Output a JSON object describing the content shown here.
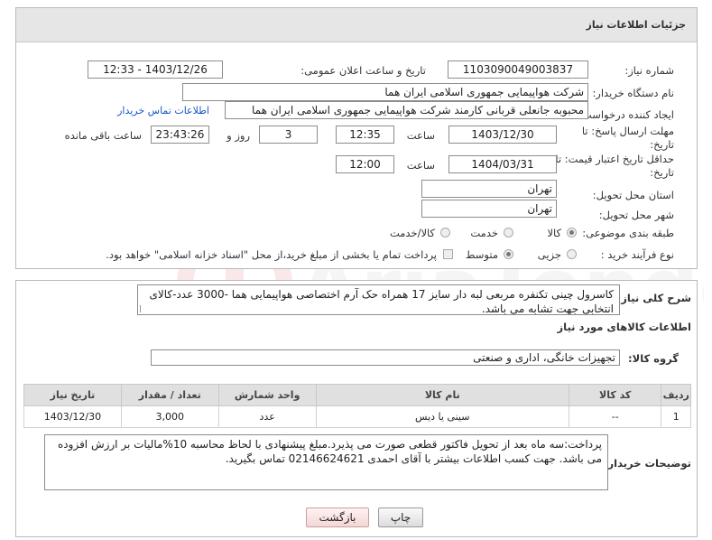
{
  "header": {
    "title": "جزئیات اطلاعات نیاز"
  },
  "form": {
    "need_number_label": "شماره نیاز:",
    "need_number": "1103090049003837",
    "announce_label": "تاریخ و ساعت اعلان عمومی:",
    "announce_value": "1403/12/26 - 12:33",
    "buyer_label": "نام دستگاه خریدار:",
    "buyer": "شرکت هواپیمایی جمهوری اسلامی ایران هما",
    "creator_label": "ایجاد کننده درخواست:",
    "creator": "محبوبه جانعلی قربانی کارمند شرکت هواپیمایی جمهوری اسلامی ایران هما",
    "contact_link": "اطلاعات تماس خریدار",
    "deadline_label_1": "مهلت ارسال پاسخ: تا",
    "deadline_label_2": "تاریخ:",
    "deadline_date": "1403/12/30",
    "time_label": "ساعت",
    "deadline_time": "12:35",
    "days_value": "3",
    "days_label": "روز و",
    "remaining_time": "23:43:26",
    "remaining_label": "ساعت باقی مانده",
    "validity_label_1": "حداقل تاریخ اعتبار قیمت: تا",
    "validity_label_2": "تاریخ:",
    "validity_date": "1404/03/31",
    "validity_time": "12:00",
    "province_label": "استان محل تحویل:",
    "province": "تهران",
    "city_label": "شهر محل تحویل:",
    "city": "تهران",
    "category_label": "طبقه بندی موضوعی:",
    "category_options": [
      "کالا",
      "خدمت",
      "کالا/خدمت"
    ],
    "process_label": "نوع فرآیند خرید :",
    "process_options": [
      "جزیی",
      "متوسط"
    ],
    "payment_note": "پرداخت تمام یا بخشی از مبلغ خرید،از محل \"اسناد خزانه اسلامی\" خواهد بود."
  },
  "description": {
    "summary_label": "شرح کلی نیاز:",
    "summary": "کاسرول چینی  تکنفره مربعی لبه دار سایز 17 همراه حک آرم اختصاصی هواپیمایی هما -3000 عدد-کالای انتخابی جهت تشابه می باشد.",
    "goods_info_title": "اطلاعات کالاهای مورد نیاز",
    "group_label": "گروه کالا:",
    "group_value": "تجهیزات خانگی، اداری و صنعتی"
  },
  "table": {
    "headers": [
      "ردیف",
      "کد کالا",
      "نام کالا",
      "واحد شمارش",
      "تعداد / مقدار",
      "تاریخ نیاز"
    ],
    "rows": [
      [
        "1",
        "--",
        "سینی یا دیس",
        "عدد",
        "3,000",
        "1403/12/30"
      ]
    ]
  },
  "buyer_notes": {
    "label": "توضیحات خریدار:",
    "text": "پرداخت:سه ماه بعد از تحویل فاکتور قطعی صورت می پذیرد.مبلغ پیشنهادی با لحاظ محاسبه 10%مالیات بر ارزش افزوده می باشد. جهت کسب اطلاعات بیشتر با آقای احمدی 02146624621 تماس بگیرید."
  },
  "buttons": {
    "print": "چاپ",
    "back": "بازگشت"
  },
  "colors": {
    "link": "#1a56c7",
    "header_bg": "#e6e6e6",
    "back_button": "#f5d6d6"
  }
}
